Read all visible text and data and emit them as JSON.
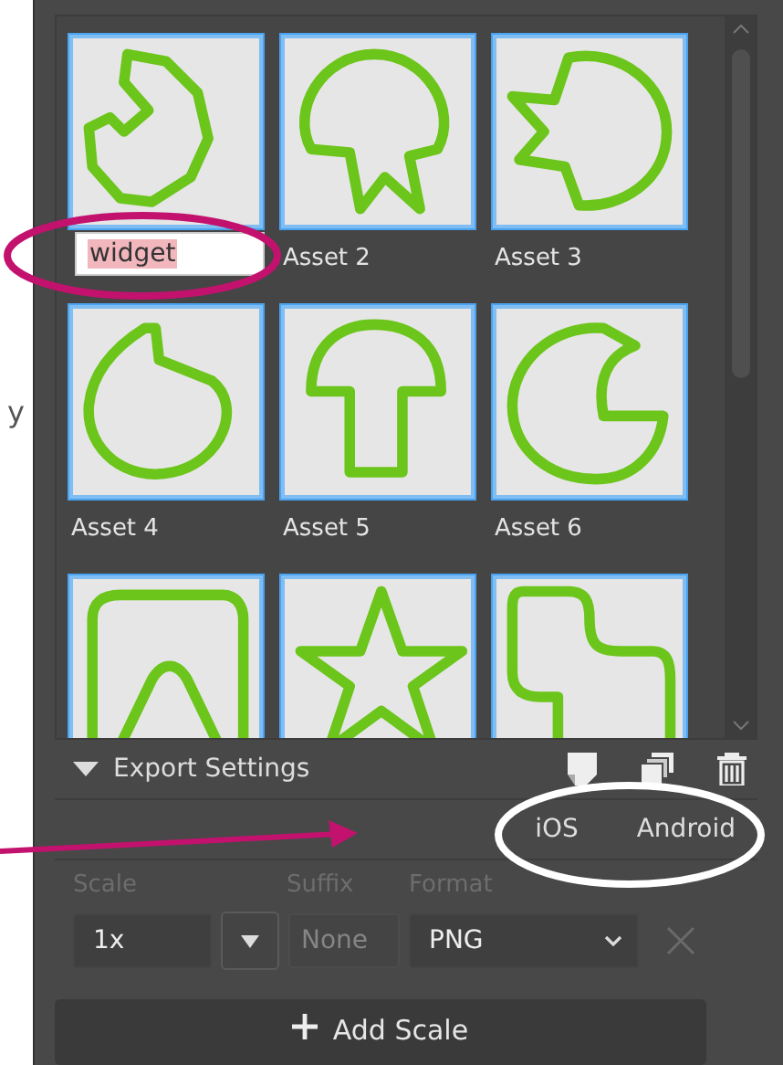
{
  "side_text": "y",
  "assets": [
    {
      "kind": "editing",
      "label": "widget"
    },
    {
      "kind": "normal",
      "label": "Asset 2"
    },
    {
      "kind": "normal",
      "label": "Asset 3"
    },
    {
      "kind": "normal",
      "label": "Asset 4"
    },
    {
      "kind": "normal",
      "label": "Asset 5"
    },
    {
      "kind": "normal",
      "label": "Asset 6"
    },
    {
      "kind": "partial"
    },
    {
      "kind": "partial"
    },
    {
      "kind": "partial"
    }
  ],
  "export_settings": {
    "title": "Export Settings",
    "expanded": true,
    "presets": [
      "iOS",
      "Android"
    ],
    "columns": [
      "Scale",
      "Suffix",
      "Format"
    ],
    "row": {
      "scale": "1x",
      "suffix_placeholder": "None",
      "format": "PNG"
    },
    "add_button": "Add Scale"
  },
  "annotations": [
    {
      "kind": "ellipse",
      "color": "#c2126e"
    },
    {
      "kind": "arrow",
      "color": "#c2126e"
    },
    {
      "kind": "ellipse",
      "color": "#ffffff"
    }
  ]
}
